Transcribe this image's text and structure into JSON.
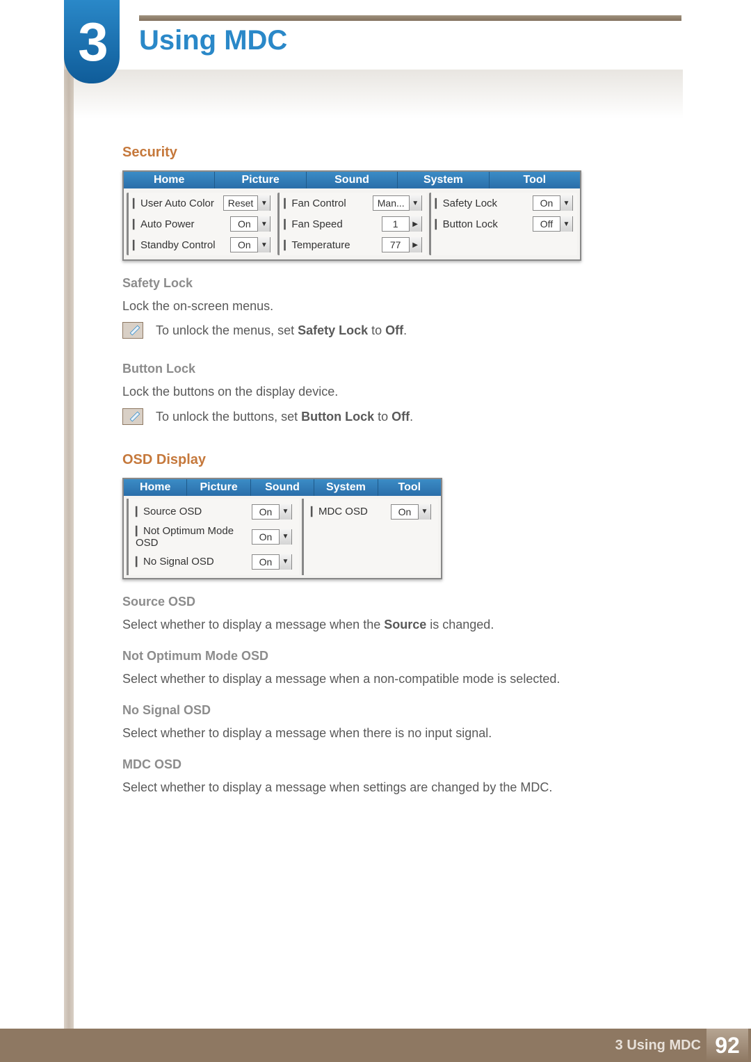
{
  "chapter": {
    "number": "3",
    "title": "Using MDC"
  },
  "footer": {
    "label": "3 Using MDC",
    "page": "92"
  },
  "security": {
    "heading": "Security",
    "tabs": [
      "Home",
      "Picture",
      "Sound",
      "System",
      "Tool"
    ],
    "col1": [
      {
        "label": "User Auto Color",
        "value": "Reset",
        "type": "drop"
      },
      {
        "label": "Auto Power",
        "value": "On",
        "type": "drop"
      },
      {
        "label": "Standby Control",
        "value": "On",
        "type": "drop"
      }
    ],
    "col2": [
      {
        "label": "Fan Control",
        "value": "Man...",
        "type": "drop"
      },
      {
        "label": "Fan Speed",
        "value": "1",
        "type": "spinner"
      },
      {
        "label": "Temperature",
        "value": "77",
        "type": "spinner"
      }
    ],
    "col3": [
      {
        "label": "Safety Lock",
        "value": "On",
        "type": "drop"
      },
      {
        "label": "Button Lock",
        "value": "Off",
        "type": "drop"
      }
    ],
    "safety_lock": {
      "title": "Safety Lock",
      "desc": "Lock the on-screen menus.",
      "note_prefix": "To unlock the menus, set ",
      "note_bold": "Safety Lock",
      "note_mid": " to ",
      "note_bold2": "Off",
      "note_suffix": "."
    },
    "button_lock": {
      "title": "Button Lock",
      "desc": "Lock the buttons on the display device.",
      "note_prefix": "To unlock the buttons, set ",
      "note_bold": "Button Lock",
      "note_mid": " to ",
      "note_bold2": "Off",
      "note_suffix": "."
    }
  },
  "osd": {
    "heading": "OSD Display",
    "tabs": [
      "Home",
      "Picture",
      "Sound",
      "System",
      "Tool"
    ],
    "left": [
      {
        "label": "Source OSD",
        "value": "On"
      },
      {
        "label": "Not Optimum Mode OSD",
        "value": "On"
      },
      {
        "label": "No Signal OSD",
        "value": "On"
      }
    ],
    "right": [
      {
        "label": "MDC OSD",
        "value": "On"
      }
    ],
    "items": [
      {
        "title": "Source OSD",
        "desc_pre": "Select whether to display a message when the ",
        "desc_bold": "Source",
        "desc_post": " is changed."
      },
      {
        "title": "Not Optimum Mode OSD",
        "desc_pre": "Select whether to display a message when a non-compatible mode is selected.",
        "desc_bold": "",
        "desc_post": ""
      },
      {
        "title": "No Signal OSD",
        "desc_pre": "Select whether to display a message when there is no input signal.",
        "desc_bold": "",
        "desc_post": ""
      },
      {
        "title": "MDC OSD",
        "desc_pre": "Select whether to display a message when settings are changed by the MDC.",
        "desc_bold": "",
        "desc_post": ""
      }
    ]
  }
}
